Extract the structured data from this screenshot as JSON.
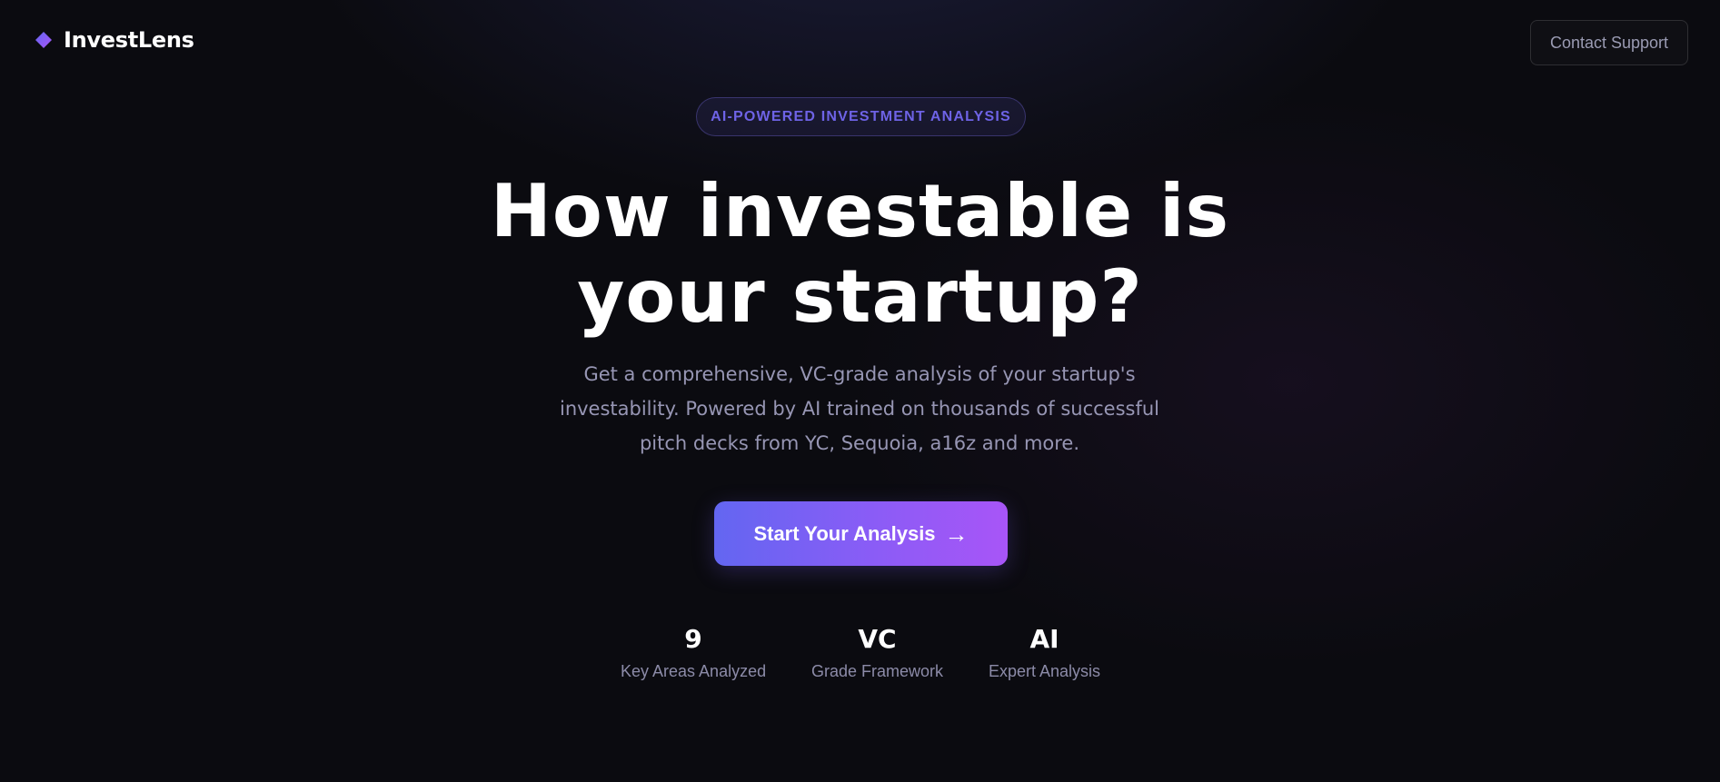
{
  "app": {
    "name": "InvestLens",
    "logo_icon": "diamond-icon",
    "accent_color": "#7c5cf0"
  },
  "header": {
    "support_label": "Contact Support"
  },
  "hero": {
    "badge": "AI-POWERED INVESTMENT ANALYSIS",
    "headline_line1": "How investable is",
    "headline_line2": "your startup?",
    "subtitle": "Get a comprehensive, VC-grade analysis of your startup's investability. Powered by AI trained on thousands of successful pitch decks from YC, Sequoia, a16z and more.",
    "cta_label": "Start Your Analysis",
    "cta_icon": "arrow-right-icon",
    "cta_gradient": [
      "#6366f1",
      "#a855f7"
    ]
  },
  "stats": [
    {
      "value": "9",
      "label": "Key Areas Analyzed"
    },
    {
      "value": "VC",
      "label": "Grade Framework"
    },
    {
      "value": "AI",
      "label": "Expert Analysis"
    }
  ]
}
